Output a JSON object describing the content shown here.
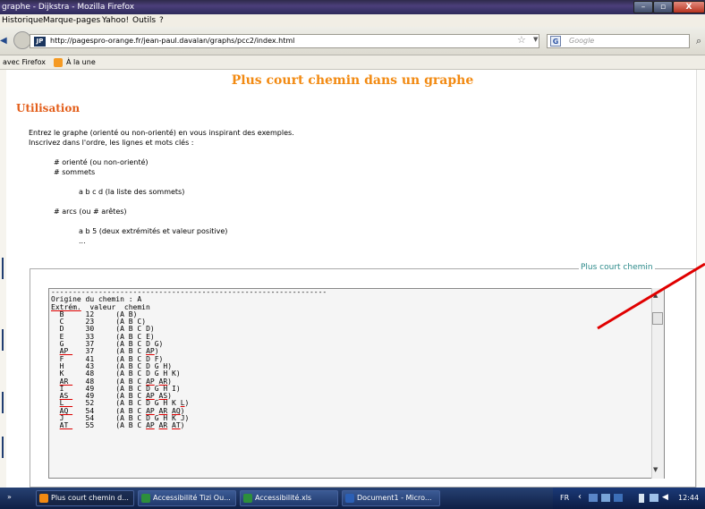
{
  "window": {
    "title": "graphe - Dijkstra - Mozilla Firefox",
    "minimize": "–",
    "maximize": "▫",
    "close": "X"
  },
  "menu": {
    "items": [
      "Historique",
      "Marque-pages",
      "Yahoo!",
      "Outils",
      "?"
    ]
  },
  "nav": {
    "url": "http://pagespro-orange.fr/jean-paul.davalan/graphs/pcc2/index.html",
    "favicon": "JP",
    "search_placeholder": "Google",
    "search_logo": "G"
  },
  "bookmarks": {
    "items": [
      "avec Firefox",
      "À la une"
    ]
  },
  "page": {
    "title": "Plus court chemin dans un graphe",
    "section": "Utilisation",
    "intro1": "Entrez le graphe (orienté ou non-orienté) en vous inspirant des exemples.",
    "intro2": "Inscrivez dans l'ordre, les lignes et mots clés :",
    "kw1": "# orienté (ou non-orienté)",
    "kw2": "# sommets",
    "ex1": "a b c d (la liste des sommets)",
    "kw3": "# arcs (ou # arêtes)",
    "ex2": "a b 5 (deux extrémités et valeur positive)",
    "ellipsis": "...",
    "legend": "Plus court chemin"
  },
  "output": {
    "separator": "----------------------------------------------------------------",
    "origin": "Origine du chemin : A",
    "header": [
      "Extrém.",
      "valeur",
      "chemin"
    ],
    "rows": [
      [
        "B",
        "12",
        "(A B)"
      ],
      [
        "C",
        "23",
        "(A B C)"
      ],
      [
        "D",
        "30",
        "(A B C D)"
      ],
      [
        "E",
        "33",
        "(A B C E)"
      ],
      [
        "G",
        "37",
        "(A B C D G)"
      ],
      [
        "AP",
        "37",
        "(A B C AP)"
      ],
      [
        "F",
        "41",
        "(A B C D F)"
      ],
      [
        "H",
        "43",
        "(A B C D G H)"
      ],
      [
        "K",
        "48",
        "(A B C D G H K)"
      ],
      [
        "AR",
        "48",
        "(A B C AP AR)"
      ],
      [
        "I",
        "49",
        "(A B C D G H I)"
      ],
      [
        "AS",
        "49",
        "(A B C AP AS)"
      ],
      [
        "L",
        "52",
        "(A B C D G H K L)"
      ],
      [
        "AQ",
        "54",
        "(A B C AP AR AQ)"
      ],
      [
        "J",
        "54",
        "(A B C D G H K J)"
      ],
      [
        "AT",
        "55",
        "(A B C AP AR AT)"
      ]
    ]
  },
  "taskbar": {
    "start": "»",
    "tasks": [
      "Plus court chemin d...",
      "Accessibilité Tizi Ou...",
      "Accessibilité.xls",
      "Document1 - Micro..."
    ],
    "lang": "FR",
    "time": "12:44"
  },
  "colors": {
    "title_orange": "#f28a12",
    "section_orange": "#e35e1a",
    "legend_teal": "#2c8a8a",
    "annotation_red": "#e00000"
  }
}
